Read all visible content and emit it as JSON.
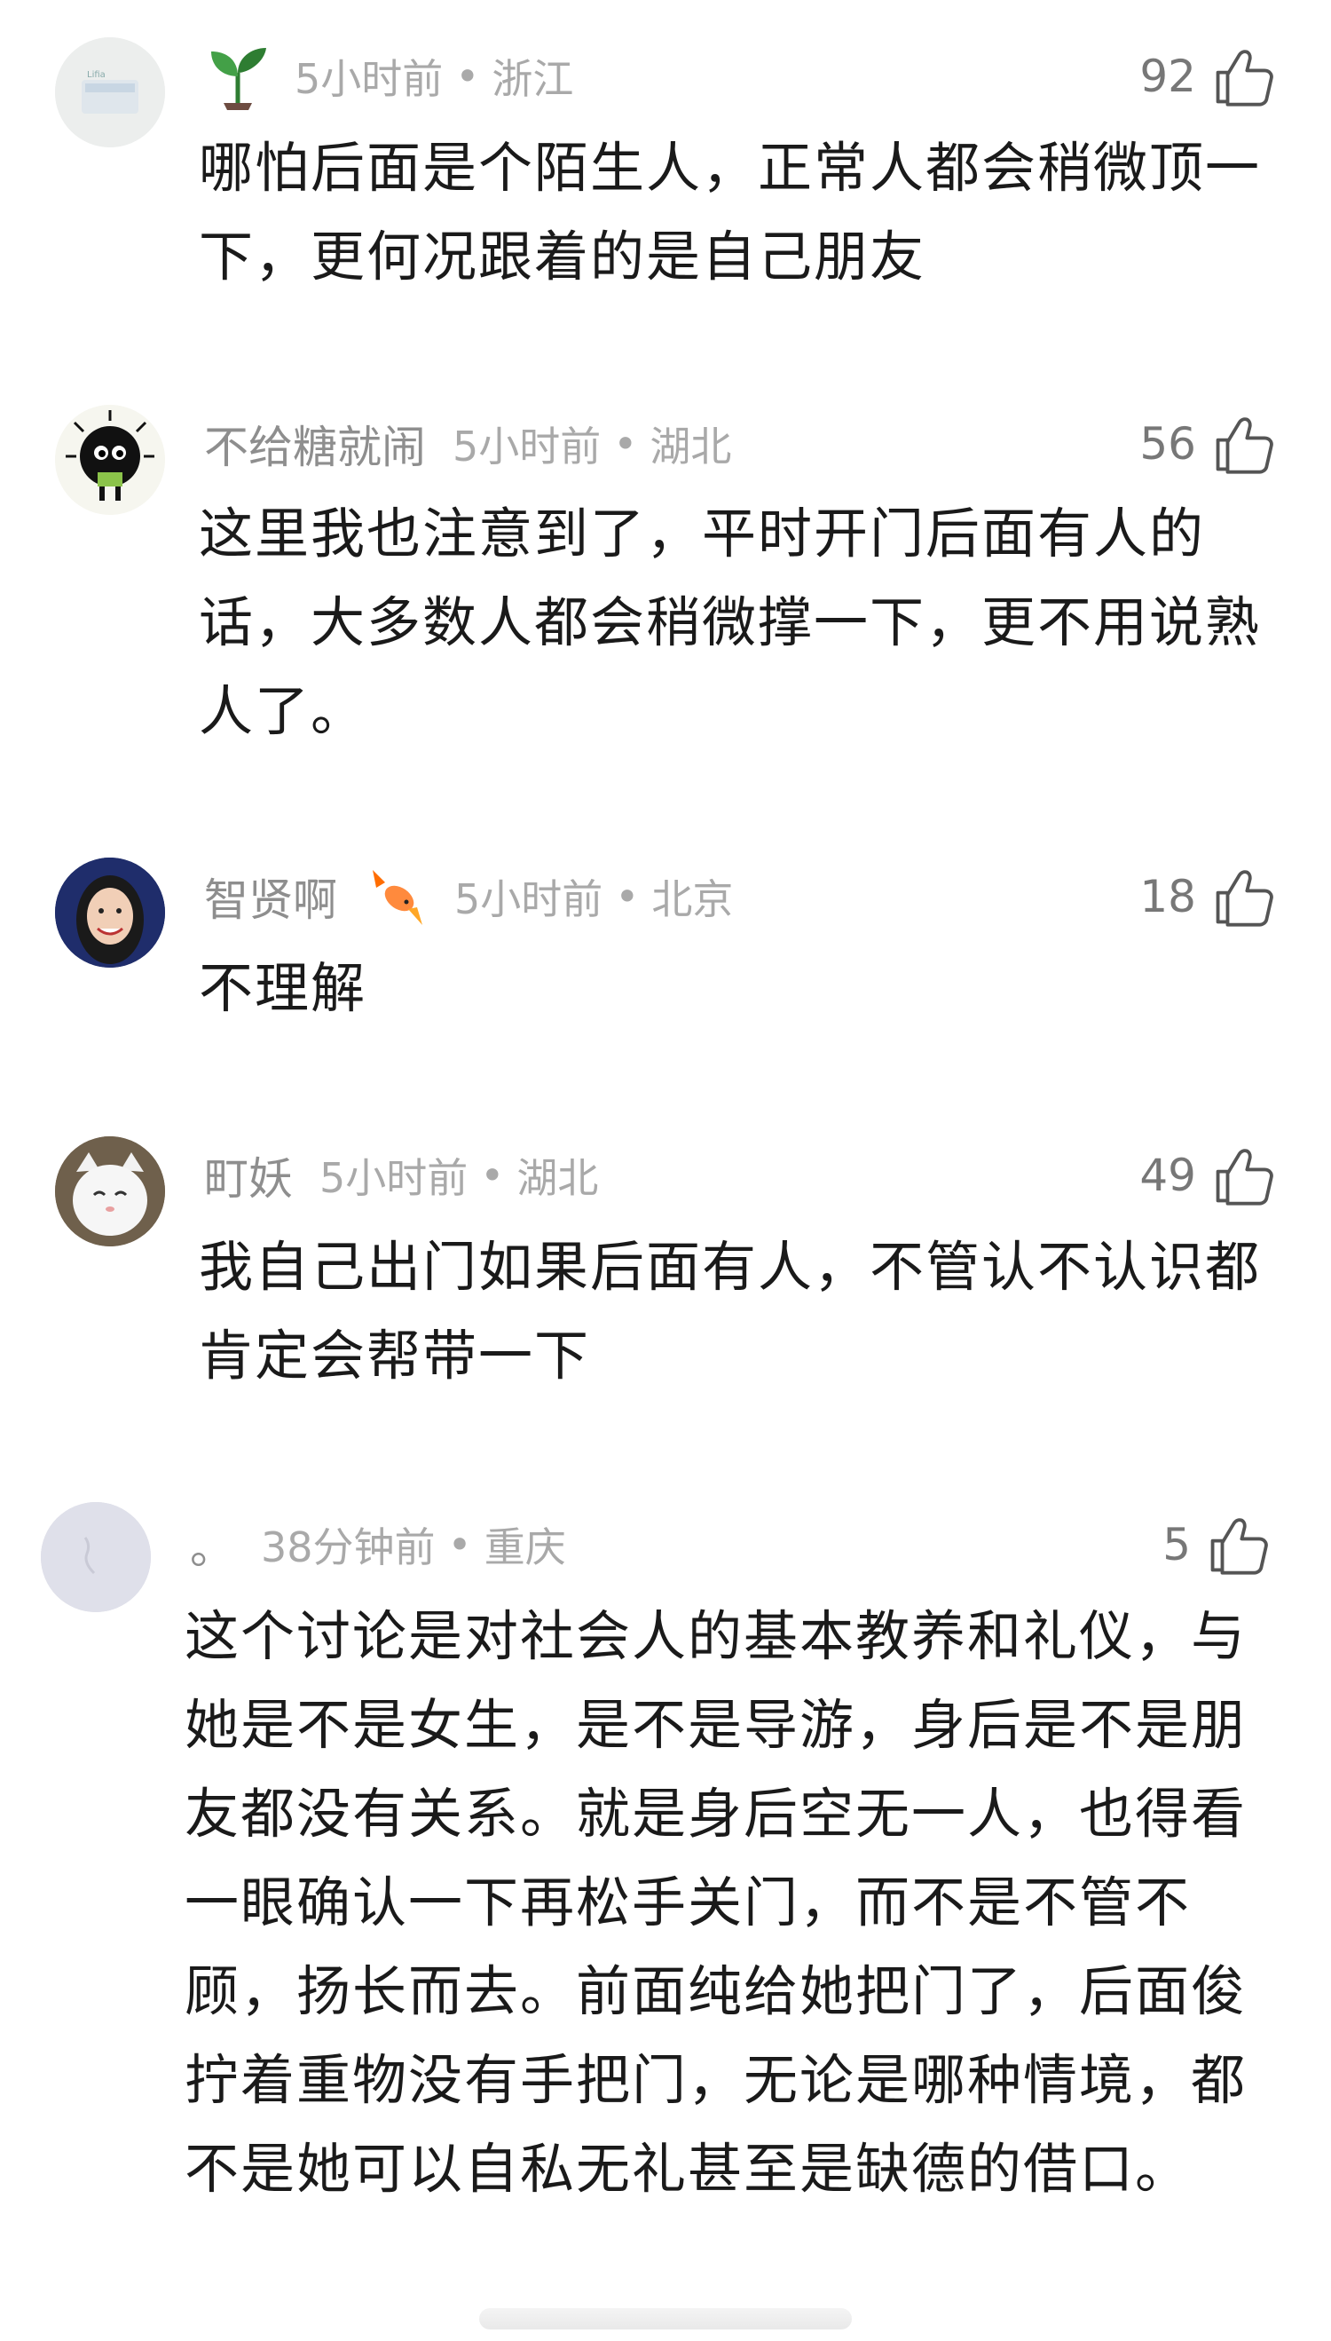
{
  "comments": [
    {
      "username": "",
      "badge_icon": "seedling-icon",
      "time": "5小时前",
      "location": "浙江",
      "likes": "92",
      "text": "哪怕后面是个陌生人，正常人都会稍微顶一下，更何况跟着的是自己朋友"
    },
    {
      "username": "不给糖就闹",
      "time": "5小时前",
      "location": "湖北",
      "likes": "56",
      "text": "这里我也注意到了，平时开门后面有人的话，大多数人都会稍微撑一下，更不用说熟人了。"
    },
    {
      "username": "智贤啊",
      "badge_icon": "goldfish-icon",
      "time": "5小时前",
      "location": "北京",
      "likes": "18",
      "text": "不理解"
    },
    {
      "username": "町妖",
      "time": "5小时前",
      "location": "湖北",
      "likes": "49",
      "text": "我自己出门如果后面有人，不管认不认识都肯定会帮带一下"
    },
    {
      "username": "。",
      "time": "38分钟前",
      "location": "重庆",
      "likes": "5",
      "text": "这个讨论是对社会人的基本教养和礼仪，与她是不是女生，是不是导游，身后是不是朋友都没有关系。就是身后空无一人，也得看一眼确认一下再松手关门，而不是不管不顾，扬长而去。前面纯给她把门了，后面俊拧着重物没有手把门，无论是哪种情境，都不是她可以自私无礼甚至是缺德的借口。"
    }
  ],
  "dot": "•",
  "colors": {
    "meta": "#a9a9a9",
    "username": "#8e8e8e",
    "text": "#1a1a1a"
  }
}
